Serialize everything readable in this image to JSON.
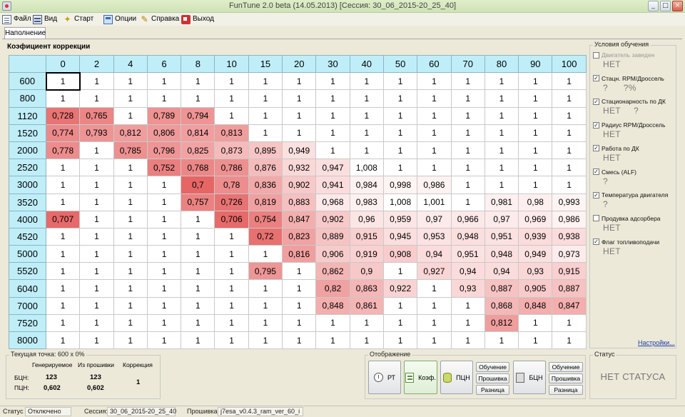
{
  "window": {
    "title": "FunTune 2.0 beta (14.05.2013) [Сессия: 30_06_2015-20_25_40]"
  },
  "menu": [
    "Файл",
    "Вид",
    "Старт",
    "Опции",
    "Справка",
    "Выход"
  ],
  "tabs": [
    "Наполнение"
  ],
  "table_title": "Коэфициент коррекции",
  "columns": [
    "0",
    "2",
    "4",
    "6",
    "8",
    "10",
    "15",
    "20",
    "30",
    "40",
    "50",
    "60",
    "70",
    "80",
    "90",
    "100"
  ],
  "rows": [
    {
      "label": "600",
      "values": [
        "1",
        "1",
        "1",
        "1",
        "1",
        "1",
        "1",
        "1",
        "1",
        "1",
        "1",
        "1",
        "1",
        "1",
        "1",
        "1"
      ]
    },
    {
      "label": "800",
      "values": [
        "1",
        "1",
        "1",
        "1",
        "1",
        "1",
        "1",
        "1",
        "1",
        "1",
        "1",
        "1",
        "1",
        "1",
        "1",
        "1"
      ]
    },
    {
      "label": "1120",
      "values": [
        "0,728",
        "0,765",
        "1",
        "0,789",
        "0,794",
        "1",
        "1",
        "1",
        "1",
        "1",
        "1",
        "1",
        "1",
        "1",
        "1",
        "1"
      ]
    },
    {
      "label": "1520",
      "values": [
        "0,774",
        "0,793",
        "0,812",
        "0,806",
        "0,814",
        "0,813",
        "1",
        "1",
        "1",
        "1",
        "1",
        "1",
        "1",
        "1",
        "1",
        "1"
      ]
    },
    {
      "label": "2000",
      "values": [
        "0,778",
        "1",
        "0,785",
        "0,796",
        "0,825",
        "0,873",
        "0,895",
        "0,949",
        "1",
        "1",
        "1",
        "1",
        "1",
        "1",
        "1",
        "1"
      ]
    },
    {
      "label": "2520",
      "values": [
        "1",
        "1",
        "1",
        "0,752",
        "0,768",
        "0,786",
        "0,876",
        "0,932",
        "0,947",
        "1,008",
        "1",
        "1",
        "1",
        "1",
        "1",
        "1"
      ]
    },
    {
      "label": "3000",
      "values": [
        "1",
        "1",
        "1",
        "1",
        "0,7",
        "0,78",
        "0,836",
        "0,902",
        "0,941",
        "0,984",
        "0,998",
        "0,986",
        "1",
        "1",
        "1",
        "1"
      ]
    },
    {
      "label": "3520",
      "values": [
        "1",
        "1",
        "1",
        "1",
        "0,757",
        "0,726",
        "0,819",
        "0,883",
        "0,968",
        "0,983",
        "1,008",
        "1,001",
        "1",
        "0,981",
        "0,98",
        "0,993"
      ]
    },
    {
      "label": "4000",
      "values": [
        "0,707",
        "1",
        "1",
        "1",
        "1",
        "0,706",
        "0,754",
        "0,847",
        "0,902",
        "0,96",
        "0,959",
        "0,97",
        "0,966",
        "0,97",
        "0,969",
        "0,986"
      ]
    },
    {
      "label": "4520",
      "values": [
        "1",
        "1",
        "1",
        "1",
        "1",
        "1",
        "0,72",
        "0,823",
        "0,889",
        "0,915",
        "0,945",
        "0,953",
        "0,948",
        "0,951",
        "0,939",
        "0,938"
      ]
    },
    {
      "label": "5000",
      "values": [
        "1",
        "1",
        "1",
        "1",
        "1",
        "1",
        "1",
        "0,816",
        "0,906",
        "0,919",
        "0,908",
        "0,94",
        "0,951",
        "0,948",
        "0,949",
        "0,973"
      ]
    },
    {
      "label": "5520",
      "values": [
        "1",
        "1",
        "1",
        "1",
        "1",
        "1",
        "0,795",
        "1",
        "0,862",
        "0,9",
        "1",
        "0,927",
        "0,94",
        "0,94",
        "0,93",
        "0,915"
      ]
    },
    {
      "label": "6040",
      "values": [
        "1",
        "1",
        "1",
        "1",
        "1",
        "1",
        "1",
        "1",
        "0,82",
        "0,863",
        "0,922",
        "1",
        "0,93",
        "0,887",
        "0,905",
        "0,887"
      ]
    },
    {
      "label": "7000",
      "values": [
        "1",
        "1",
        "1",
        "1",
        "1",
        "1",
        "1",
        "1",
        "0,848",
        "0,861",
        "1",
        "1",
        "1",
        "0,868",
        "0,848",
        "0,847"
      ]
    },
    {
      "label": "7520",
      "values": [
        "1",
        "1",
        "1",
        "1",
        "1",
        "1",
        "1",
        "1",
        "1",
        "1",
        "1",
        "1",
        "1",
        "0,812",
        "1",
        "1"
      ]
    },
    {
      "label": "8000",
      "values": [
        "1",
        "1",
        "1",
        "1",
        "1",
        "1",
        "1",
        "1",
        "1",
        "1",
        "1",
        "1",
        "1",
        "1",
        "1",
        "1"
      ]
    }
  ],
  "conditions": {
    "title": "Условия обучения",
    "items": [
      {
        "label": "Двигатель заведен",
        "checked": false,
        "disabled": true,
        "value": "НЕТ"
      },
      {
        "label": "Стацн. RPM/Дроссель",
        "checked": true,
        "disabled": false,
        "value": "?      ?%"
      },
      {
        "label": "Стационарность по ДК",
        "checked": true,
        "disabled": false,
        "value": "НЕТ     ?"
      },
      {
        "label": "Радиус RPM/Дроссель",
        "checked": true,
        "disabled": false,
        "value": "НЕТ"
      },
      {
        "label": "Работа по ДК",
        "checked": true,
        "disabled": false,
        "value": "НЕТ"
      },
      {
        "label": "Смесь (ALF)",
        "checked": true,
        "disabled": false,
        "value": "?"
      },
      {
        "label": "Температура двигателя",
        "checked": true,
        "disabled": false,
        "value": "?"
      },
      {
        "label": "Продувка адсорбера",
        "checked": false,
        "disabled": false,
        "value": "НЕТ"
      },
      {
        "label": "Флаг топливоподачи",
        "checked": true,
        "disabled": false,
        "value": "НЕТ"
      }
    ],
    "settings_link": "Настройки..."
  },
  "current_point": {
    "title": "Текущая точка: 600 x 0%",
    "col_generated": "Генерируемое",
    "col_firmware": "Из прошивки",
    "col_correction": "Коррекция",
    "row1_label": "БЦН:",
    "row2_label": "ПЦН:",
    "gen_bcn": "123",
    "fw_bcn": "123",
    "gen_pcn": "0,602",
    "fw_pcn": "0,602",
    "correction": "1"
  },
  "display": {
    "title": "Отображение",
    "btn_rt": "РТ",
    "btn_koef": "Коэф.",
    "btn_pcn": "ПЦН",
    "btn_bcn": "БЦН",
    "learn": "Обучение",
    "firmware": "Прошивка",
    "diff": "Разница"
  },
  "status": {
    "title": "Статус",
    "text": "НЕТ СТАТУСА"
  },
  "statusbar": {
    "status_label": "Статус",
    "status_value": "Отключено",
    "session_label": "Сессия:",
    "session_value": "30_06_2015-20_25_40",
    "firmware_label": "Прошивка:",
    "firmware_value": "j7esa_v0.4.3_ram_ver_60_i"
  }
}
